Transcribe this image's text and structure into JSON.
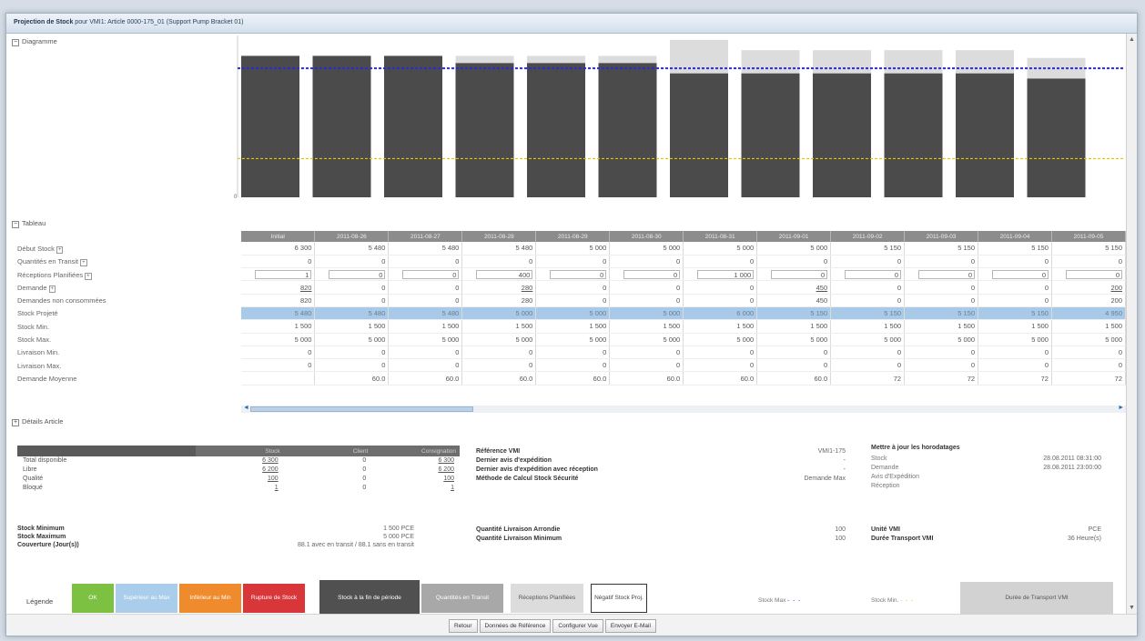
{
  "window": {
    "title_bold": "Projection de Stock",
    "title_rest": " pour VMI1: Article 0000-175_01 (Support Pump Bracket 01)"
  },
  "sections": {
    "diagram": "Diagramme",
    "table": "Tableau",
    "details": "Détails Article"
  },
  "chart_data": {
    "type": "bar",
    "categories": [
      "Initial",
      "2011-08-26",
      "2011-08-27",
      "2011-08-28",
      "2011-08-29",
      "2011-08-30",
      "2011-08-31",
      "2011-09-01",
      "2011-09-02",
      "2011-09-03",
      "2011-09-04",
      "2011-09-05"
    ],
    "series": [
      {
        "name": "Stock à la fin de période",
        "color": "#4b4b4b",
        "values": [
          5480,
          5480,
          5480,
          5200,
          5200,
          5200,
          4800,
          4800,
          4800,
          4800,
          4800,
          4600
        ]
      },
      {
        "name": "Stock Max",
        "color": "#2b2bd6",
        "values": [
          5000,
          5000,
          5000,
          5000,
          5000,
          5000,
          5000,
          5000,
          5000,
          5000,
          5000,
          5000
        ]
      },
      {
        "name": "Stock Min",
        "color": "#e6c200",
        "values": [
          1500,
          1500,
          1500,
          1500,
          1500,
          1500,
          1500,
          1500,
          1500,
          1500,
          1500,
          1500
        ]
      },
      {
        "name": "Quantité prévisionnelle",
        "color": "#dcdcdc",
        "values": [
          0,
          0,
          0,
          5480,
          5480,
          5480,
          6100,
          5700,
          5700,
          5700,
          5700,
          5400
        ]
      }
    ],
    "ylim": [
      0,
      6200
    ],
    "ytick_label": "0",
    "legend": "bottom"
  },
  "table": {
    "headers": [
      "Initial",
      "2011-08-26",
      "2011-08-27",
      "2011-08-28",
      "2011-08-29",
      "2011-08-30",
      "2011-08-31",
      "2011-09-01",
      "2011-09-02",
      "2011-09-03",
      "2011-09-04",
      "2011-09-05"
    ],
    "row_labels": [
      "Début Stock",
      "Quantités en Transit",
      "Réceptions Planifiées",
      "Demande",
      "Demandes non consommées",
      "Stock Projeté",
      "Stock Min.",
      "Stock Max.",
      "Livraison Min.",
      "Livraison Max.",
      "Demande Moyenne"
    ],
    "rows": [
      [
        "6 300",
        "5 480",
        "5 480",
        "5 480",
        "5 000",
        "5 000",
        "5 000",
        "5 000",
        "5 150",
        "5 150",
        "5 150",
        "5 150"
      ],
      [
        "0",
        "0",
        "0",
        "0",
        "0",
        "0",
        "0",
        "0",
        "0",
        "0",
        "0",
        "0"
      ],
      [
        "1",
        "0",
        "0",
        "400",
        "0",
        "0",
        "1 000",
        "0",
        "0",
        "0",
        "0",
        "0"
      ],
      [
        "820",
        "0",
        "0",
        "280",
        "0",
        "0",
        "0",
        "450",
        "0",
        "0",
        "0",
        "200"
      ],
      [
        "820",
        "0",
        "0",
        "280",
        "0",
        "0",
        "0",
        "450",
        "0",
        "0",
        "0",
        "200"
      ],
      [
        "5 480",
        "5 480",
        "5 480",
        "5 000",
        "5 000",
        "5 000",
        "6 000",
        "5 150",
        "5 150",
        "5 150",
        "5 150",
        "4 950"
      ],
      [
        "1 500",
        "1 500",
        "1 500",
        "1 500",
        "1 500",
        "1 500",
        "1 500",
        "1 500",
        "1 500",
        "1 500",
        "1 500",
        "1 500"
      ],
      [
        "5 000",
        "5 000",
        "5 000",
        "5 000",
        "5 000",
        "5 000",
        "5 000",
        "5 000",
        "5 000",
        "5 000",
        "5 000",
        "5 000"
      ],
      [
        "0",
        "0",
        "0",
        "0",
        "0",
        "0",
        "0",
        "0",
        "0",
        "0",
        "0",
        "0"
      ],
      [
        "0",
        "0",
        "0",
        "0",
        "0",
        "0",
        "0",
        "0",
        "0",
        "0",
        "0",
        "0"
      ],
      [
        "",
        "60.0",
        "60.0",
        "60.0",
        "60.0",
        "60.0",
        "60.0",
        "60.0",
        "72",
        "72",
        "72",
        "72"
      ]
    ]
  },
  "details": {
    "headers": [
      "",
      "Stock",
      "Client",
      "Consignation"
    ],
    "rows": [
      [
        "Total disponible",
        "6 300",
        "0",
        "6 300"
      ],
      [
        "Libre",
        "6 200",
        "0",
        "6 200"
      ],
      [
        "Qualité",
        "100",
        "0",
        "100"
      ],
      [
        "Bloqué",
        "1",
        "0",
        "1"
      ]
    ],
    "min_max": [
      {
        "k": "Stock Minimum",
        "v": "1 500 PCE"
      },
      {
        "k": "Stock Maximum",
        "v": "5 000 PCE"
      },
      {
        "k": "Couverture (Jour(s))",
        "v": "88.1 avec en transit / 88.1 sans en transit"
      }
    ],
    "mid": [
      {
        "k": "Référence VMI",
        "v": "VMI1-175"
      },
      {
        "k": "Dernier avis d'expédition",
        "v": "-"
      },
      {
        "k": "Dernier avis d'expédition avec réception",
        "v": "-"
      },
      {
        "k": "Méthode de Calcul Stock Sécurité",
        "v": "Demande Max"
      }
    ],
    "qty": [
      {
        "k": "Quantité Livraison Arrondie",
        "v": "100"
      },
      {
        "k": "Quantité Livraison Minimum",
        "v": "100"
      }
    ],
    "update_title": "Mettre à jour les horodatages",
    "updates": [
      {
        "k": "Stock",
        "v": "28.08.2011 08:31:00"
      },
      {
        "k": "Demande",
        "v": "28.08.2011 23:00:00"
      },
      {
        "k": "Avis d'Expédition",
        "v": ""
      },
      {
        "k": "Réception",
        "v": ""
      }
    ],
    "unit": [
      {
        "k": "Unité VMI",
        "v": "PCE"
      },
      {
        "k": "Durée Transport VMI",
        "v": "36 Heure(s)"
      }
    ]
  },
  "legend": {
    "label": "Légende",
    "items": [
      {
        "text": "OK",
        "bg": "#7cc142",
        "fg": "#ffffff"
      },
      {
        "text": "Supérieur au Max",
        "bg": "#a9cdeb",
        "fg": "#ffffff"
      },
      {
        "text": "Inférieur au Min",
        "bg": "#ef8b2c",
        "fg": "#ffffff"
      },
      {
        "text": "Rupture de Stock",
        "bg": "#d9363a",
        "fg": "#ffffff"
      },
      {
        "text": "Stock à la fin de période",
        "bg": "#505050",
        "fg": "#ffffff"
      },
      {
        "text": "Quantités en Transit",
        "bg": "#a8a8a8",
        "fg": "#ffffff"
      },
      {
        "text": "Réceptions Planifiées",
        "bg": "#dcdcdc",
        "fg": "#555555"
      },
      {
        "text": "Négatif Stock Proj.",
        "bg": "#ffffff",
        "fg": "#444444"
      }
    ],
    "stock_max": "Stock Max",
    "stock_min": "Stock Min.",
    "transport": "Durée de Transport VMI"
  },
  "footer": {
    "buttons": [
      "Retour",
      "Données de Référence",
      "Configurer Vue",
      "Envoyer E-Mail"
    ]
  }
}
